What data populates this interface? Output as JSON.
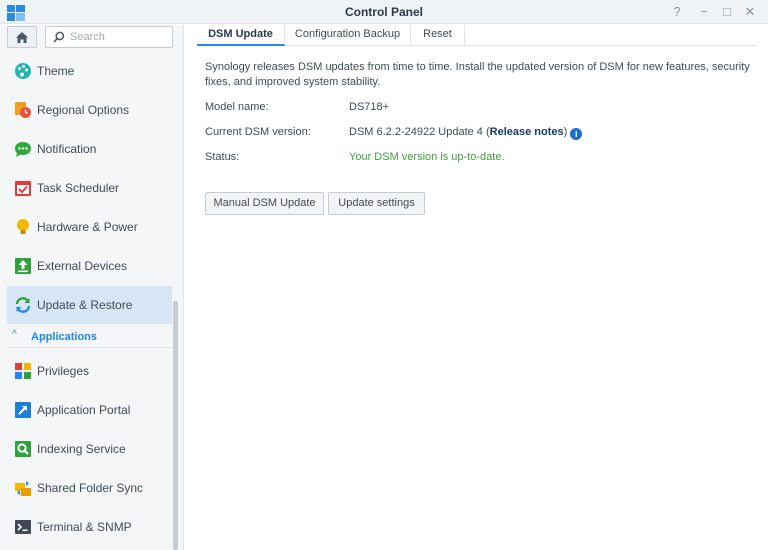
{
  "window": {
    "title": "Control Panel",
    "buttons": [
      "?",
      "−",
      "□",
      "✕"
    ]
  },
  "sidebar": {
    "search_placeholder": "Search",
    "items": [
      {
        "label": "Theme",
        "icon": "palette-icon"
      },
      {
        "label": "Regional Options",
        "icon": "clock-globe-icon"
      },
      {
        "label": "Notification",
        "icon": "chat-bubble-icon"
      },
      {
        "label": "Task Scheduler",
        "icon": "calendar-check-icon"
      },
      {
        "label": "Hardware & Power",
        "icon": "lightbulb-icon"
      },
      {
        "label": "External Devices",
        "icon": "upload-box-icon"
      },
      {
        "label": "Update & Restore",
        "icon": "refresh-icon",
        "active": true
      }
    ],
    "section": {
      "label": "Applications",
      "chevron": "^"
    },
    "app_items": [
      {
        "label": "Privileges",
        "icon": "blocks-icon"
      },
      {
        "label": "Application Portal",
        "icon": "portal-arrow-icon"
      },
      {
        "label": "Indexing Service",
        "icon": "magnifier-box-icon"
      },
      {
        "label": "Shared Folder Sync",
        "icon": "folder-sync-icon"
      },
      {
        "label": "Terminal & SNMP",
        "icon": "terminal-icon"
      }
    ]
  },
  "tabs": [
    {
      "label": "DSM Update",
      "active": true
    },
    {
      "label": "Configuration Backup"
    },
    {
      "label": "Reset"
    }
  ],
  "content": {
    "description": "Synology releases DSM updates from time to time. Install the updated version of DSM for new features, security fixes, and improved system stability.",
    "rows": [
      {
        "label": "Model name:",
        "value": "DS718+"
      },
      {
        "label": "Current DSM version:",
        "value": "DSM 6.2.2-24922 Update 4 (",
        "link": "Release notes",
        "suffix": ")",
        "info_glyph": "i"
      },
      {
        "label": "Status:",
        "value": "Your DSM version is up-to-date."
      }
    ],
    "buttons": {
      "manual_update": "Manual DSM Update",
      "update_settings": "Update settings"
    }
  },
  "colors": {
    "accent": "#1e87f0",
    "active_bg": "#d7e6f5",
    "status_ok": "#3fa13a",
    "link": "#1b3a66"
  }
}
